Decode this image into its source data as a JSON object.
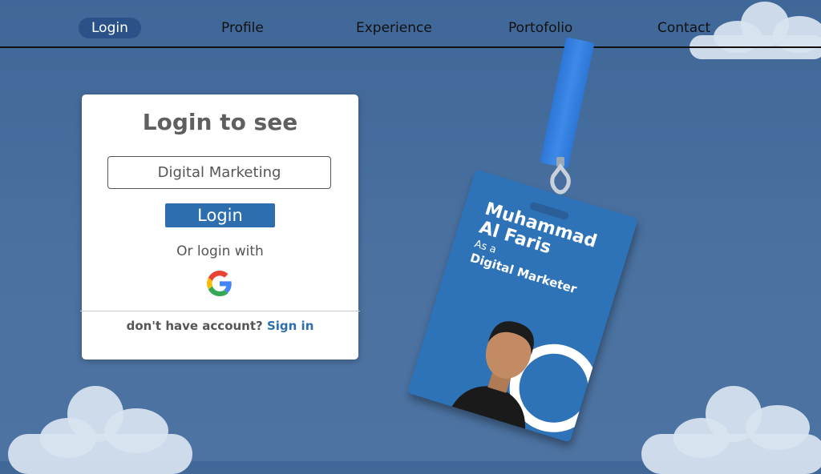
{
  "nav": {
    "items": [
      "Login",
      "Profile",
      "Experience",
      "Portofolio",
      "Contact"
    ],
    "active_index": 0
  },
  "login_card": {
    "title": "Login to see",
    "input_value": "Digital Marketing",
    "button_label": "Login",
    "or_text": "Or login with",
    "google_icon": "google-icon",
    "signup_prompt": "don't have account?",
    "signup_link": "Sign in"
  },
  "badge": {
    "name_line1": "Muhammad",
    "name_line2": "Al Faris",
    "as_a": "As a",
    "role": "Digital Marketer"
  },
  "colors": {
    "background": "#4a71a0",
    "nav_active": "#2a5289",
    "button": "#2d6fae",
    "badge": "#2e72b8",
    "link": "#2d6fae"
  }
}
